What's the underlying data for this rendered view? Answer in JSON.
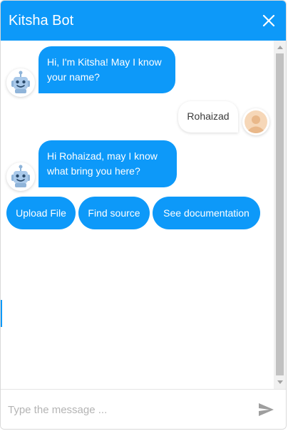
{
  "header": {
    "title": "Kitsha Bot",
    "close_icon": "close-icon"
  },
  "messages": [
    {
      "from": "bot",
      "text_line1": "Hi, I'm Kitsha! May I know",
      "text_line2": "your name?",
      "avatar_icon": "robot-icon"
    },
    {
      "from": "user",
      "text": "Rohaizad",
      "avatar_icon": "user-avatar-icon"
    },
    {
      "from": "bot",
      "text_line1": "Hi Rohaizad, may I know",
      "text_line2": "what bring you here?",
      "avatar_icon": "robot-icon"
    }
  ],
  "quick_replies": [
    "Upload File",
    "Find source",
    "See documentation"
  ],
  "composer": {
    "placeholder": "Type the message ...",
    "send_icon": "send-icon"
  },
  "colors": {
    "accent": "#0d99f9",
    "bot_text": "#ffffff",
    "user_text": "#3a3a3a",
    "placeholder": "#b4b4b4"
  }
}
